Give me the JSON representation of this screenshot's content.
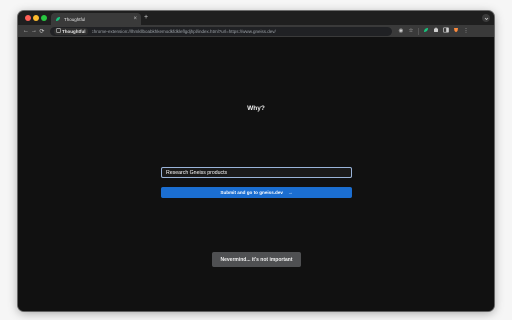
{
  "browser": {
    "tab": {
      "title": "Thoughtful",
      "favicon": "thoughtful-leaf-icon",
      "close_glyph": "×"
    },
    "new_tab_glyph": "+",
    "site_chip": {
      "label": "Thoughtful"
    },
    "url": "chrome-extension://lhmkllboabkhkemodkfdkleflgdjhpl/index.html?url=https://www.gneiss.dev/",
    "nav_icons": {
      "back": "←",
      "forward": "→",
      "reload": "⟳"
    },
    "toolbar_icons": [
      "extension-circle-icon",
      "star-icon",
      "thoughtful-extension-icon",
      "puzzle-icon",
      "sidebar-icon",
      "brave-icon",
      "menu-icon"
    ]
  },
  "page": {
    "heading": "Why?",
    "reason_input_value": "Research Gneiss products",
    "submit_label": "Submit and go to gneiss.dev",
    "submit_arrow": "→",
    "nevermind_label": "Nevermind... it's not important"
  },
  "colors": {
    "accent": "#1b6ed1",
    "background": "#111111",
    "secondary_button": "#4f5052"
  }
}
